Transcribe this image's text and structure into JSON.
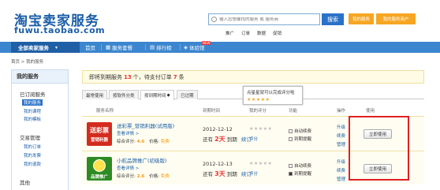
{
  "header": {
    "logo_title": "淘宝卖家服务",
    "logo_url": "fuwu.taobao.com",
    "search_placeholder": "输入您想要找的服务 或 服务商",
    "search_button": "搜索",
    "quick_links": [
      "推广",
      "订单",
      "数据",
      "促销"
    ],
    "my_service": "我的服务",
    "my_merchant": "我的服务商户"
  },
  "nav": {
    "all_services": "全部卖家服务",
    "items": [
      "首页",
      "服务套餐",
      "排行榜",
      "体验馆"
    ],
    "new_badge": "NEW"
  },
  "breadcrumb": "首页 > 我的服务",
  "sidebar": {
    "title": "我的服务",
    "group1": "已订阅服务",
    "group1_links": [
      "我的服务",
      "我的课程",
      "我的模板"
    ],
    "group2": "交易管理",
    "group2_links": [
      "我的订单",
      "我的发票",
      "我的退款"
    ],
    "group3": "其他"
  },
  "notice": {
    "prefix": "即将到期服务",
    "expiring_count": "13",
    "middle": "个，待支付订单",
    "unpaid_count": "7",
    "suffix": "条"
  },
  "tabs": [
    "最常使用",
    "按软件分类",
    "按到期时间",
    "已过期"
  ],
  "tooltip": {
    "text": "点星星就可以完成评分啦",
    "stars": "★★★★★"
  },
  "table": {
    "headers": [
      "服务名称",
      "到期时间",
      "我的评分",
      "功能",
      "操作",
      "使用"
    ],
    "rows": [
      {
        "thumb_label": "送彩票",
        "thumb_sub": "营销利器",
        "name": "送彩票_营销利器(试用版)",
        "detail_link": "查看详情 >",
        "score_label": "综合评分:",
        "score": "4.6",
        "price_label": "价格:",
        "price": "免费",
        "date": "2012-12-12",
        "remain_prefix": "还有",
        "remain_days": "2天",
        "remain_suffix": "到期",
        "renew": "续订",
        "stars": "★★★★★",
        "rate_link": "评分",
        "opt1": "自动续费",
        "opt2": "到期提醒",
        "ops": [
          "升级",
          "续费",
          "管理"
        ],
        "use": "立即使用"
      },
      {
        "thumb_label": "品牌推广",
        "thumb_sub": "",
        "name": "小舵品牌推广(初级版)",
        "detail_link": "查看详情 >",
        "score_label": "综合评分:",
        "score": "2.6",
        "price_label": "价格:",
        "price": "免费",
        "date": "2012-12-13",
        "remain_prefix": "还有",
        "remain_days": "3天",
        "remain_suffix": "到期",
        "renew": "续订",
        "stars": "★★★★★",
        "rate_link": "评分",
        "opt1": "自动续费",
        "opt2": "到期提醒",
        "ops": [
          "升级",
          "续费",
          "管理"
        ],
        "use": "立即使用"
      }
    ]
  }
}
